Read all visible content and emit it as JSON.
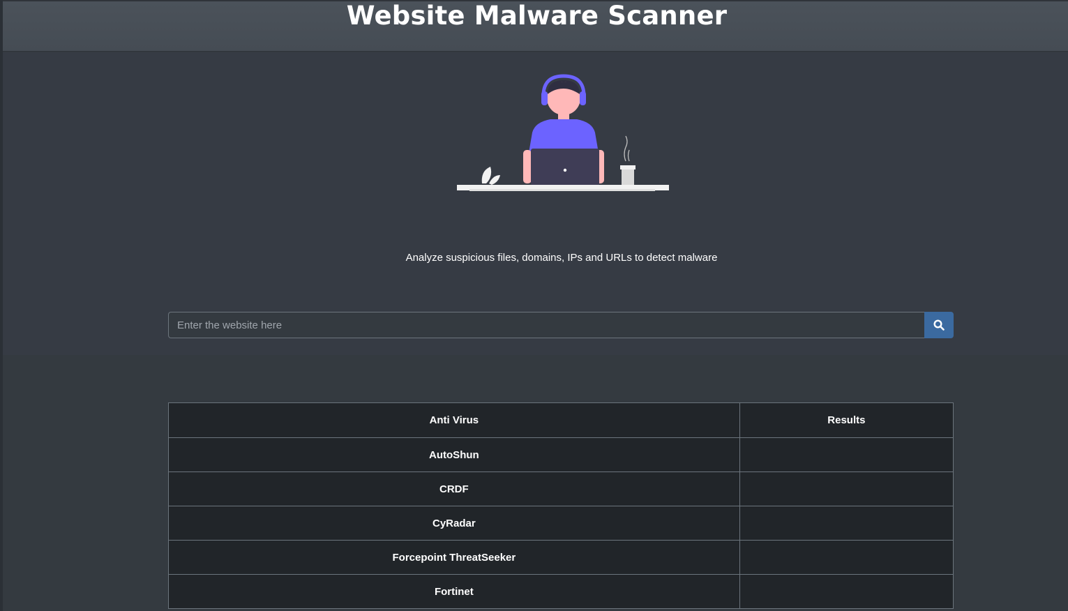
{
  "header": {
    "title": "Website Malware Scanner"
  },
  "hero": {
    "tagline": "Analyze suspicious files, domains, IPs and URLs to detect malware"
  },
  "search": {
    "placeholder": "Enter the website here",
    "value": "",
    "button_icon": "search-icon",
    "button_color": "#3b6aa0"
  },
  "table": {
    "headers": [
      "Anti Virus",
      "Results"
    ],
    "rows": [
      {
        "antivirus": "AutoShun",
        "result": ""
      },
      {
        "antivirus": "CRDF",
        "result": ""
      },
      {
        "antivirus": "CyRadar",
        "result": ""
      },
      {
        "antivirus": "Forcepoint ThreatSeeker",
        "result": ""
      },
      {
        "antivirus": "Fortinet",
        "result": ""
      }
    ]
  },
  "colors": {
    "header_bg": "#4b525a",
    "hero_bg": "#363b44",
    "page_bg": "#343a40",
    "table_bg": "#212529",
    "accent_purple": "#6c63ff"
  }
}
